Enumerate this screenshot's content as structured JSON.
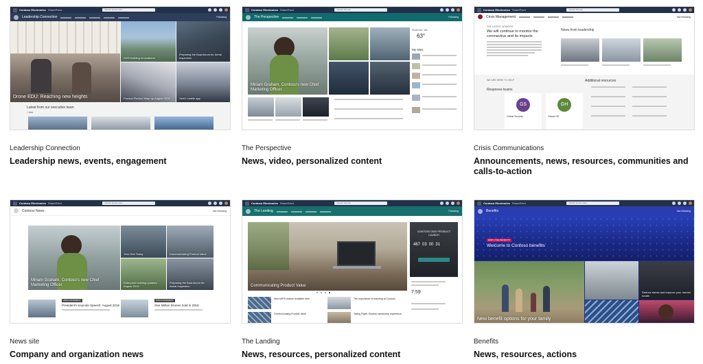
{
  "cards": [
    {
      "name": "Leadership Connection",
      "description": "Leadership news, events, engagement",
      "shot": {
        "org": "Contoso Electronics",
        "app": "SharePoint",
        "search_placeholder": "Search across sites",
        "site_title": "Leadership Connection",
        "follow": "Following",
        "tiles": [
          "Drone EDU: Reaching new heights",
          "2020 building renovations",
          "Preparing the Boardroom for Aerial Inspection",
          "Product Review Wrap up August 2019",
          "VerIO mobile app"
        ],
        "section": "Latest from our executive team",
        "add": "+ Add"
      }
    },
    {
      "name": "The Perspective",
      "description": "News, video, personalized content",
      "shot": {
        "org": "Contoso Electronics",
        "app": "SharePoint",
        "search_placeholder": "Search this site",
        "site_title": "The Perspective",
        "follow": "Following",
        "hero": "Miriam Graham, Contoso's new Chief Marketing Officer",
        "weather_city": "Redmond, WA",
        "weather_temp": "63°",
        "my_sites": "My sites"
      }
    },
    {
      "name": "Crisis Communications",
      "description": "Announcements, news, resources, communities and calls-to-action",
      "shot": {
        "org": "Contoso Electronics",
        "app": "SharePoint",
        "search_placeholder": "Search this site",
        "site_title": "Crisis Management",
        "follow": "Not following",
        "latest_label": "THE LATEST UPDATES",
        "headline": "We will continue to monitor the coronavirus and its impacts",
        "news_title": "News from leadership",
        "help_label": "WE ARE HERE TO HELP",
        "response_teams": "Response teams",
        "additional": "Additional resources",
        "team_a": "GS",
        "team_b": "GH",
        "team_a_name": "Global Security",
        "team_b_name": "Global HR"
      }
    },
    {
      "name": "News site",
      "description": "Company and organization news",
      "shot": {
        "org": "Contoso Electronics",
        "app": "SharePoint",
        "search_placeholder": "Search across sites",
        "site_title": "Contoso News",
        "follow": "Not following",
        "hero": "Miriam Graham, Contoso's new Chief Marketing Officer",
        "tiles": [
          "Year One Today",
          "Communicating Product Value",
          "Enterprise building updates August 2019",
          "Preparing the Boardroom for Aerial Inspection"
        ],
        "story_a": "President's Keynote Speech: August 2019",
        "story_b": "One Million Drones Sold in 2019",
        "badge": "ANNOUNCEMENT"
      }
    },
    {
      "name": "The Landing",
      "description": "News, resources, personalized content",
      "shot": {
        "org": "Contoso Electronics",
        "app": "SharePoint",
        "search_placeholder": "Search this site",
        "site_title": "The Landing",
        "follow": "Following",
        "hero": "Communicating Product Value",
        "event": "CONTOSO 2020 PRODUCT LAUNCH",
        "countdown": [
          "467",
          "03",
          "00",
          "31"
        ],
        "time": "7:59",
        "story_a": "New MIFIS feature available here",
        "story_b": "The importance of branding at Contoso",
        "story_c": "Communicating Product Value",
        "story_d": "Taking Flight: Student mentorship experience"
      }
    },
    {
      "name": "Benefits",
      "description": "News, resources, actions",
      "shot": {
        "org": "Contoso Electronics",
        "app": "SharePoint",
        "search_placeholder": "Search across sites",
        "site_title": "Benefits",
        "follow": "Not following",
        "badge": "EMPLOYEE BENEFITS",
        "hero": "Welcome to Contoso benefits",
        "tile_a": "New benefit options for your family",
        "tile_b": "Reduce stress and improve your mental health"
      }
    }
  ]
}
